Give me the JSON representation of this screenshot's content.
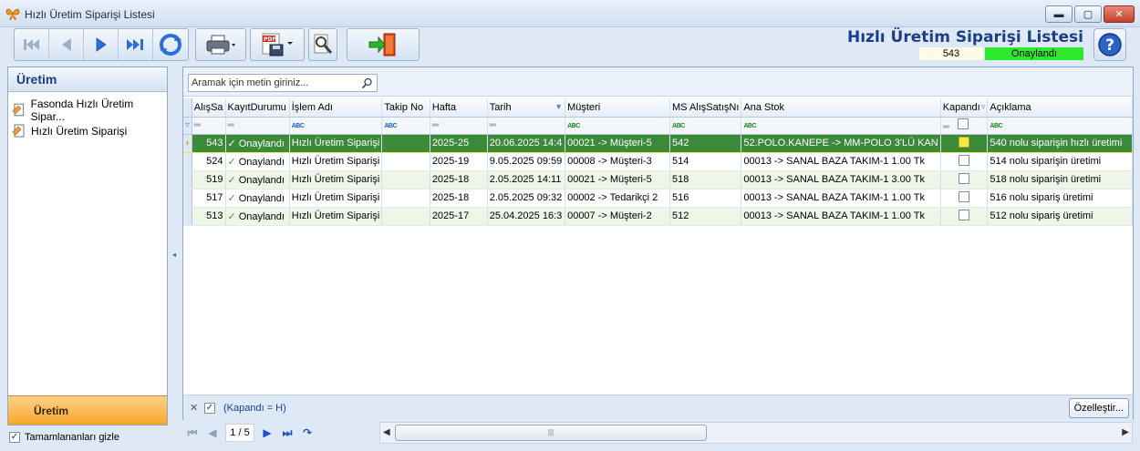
{
  "window": {
    "title": "Hızlı Üretim Siparişi Listesi",
    "buttons": {
      "minimize": "▬",
      "maximize": "▢",
      "close": "✕"
    }
  },
  "toolbar": {
    "buttons": [
      "first-record",
      "previous-record",
      "next-record",
      "last-record",
      "refresh",
      "print",
      "export-pdf",
      "search-settings",
      "exit"
    ]
  },
  "header": {
    "heading": "Hızlı Üretim Siparişi Listesi",
    "record_no": "543",
    "record_status": "Onaylandı"
  },
  "sidebar": {
    "title": "Üretim",
    "items": [
      {
        "label": "Fasonda Hızlı Üretim Sipar..."
      },
      {
        "label": "Hızlı Üretim Siparişi"
      }
    ],
    "footer": "Üretim",
    "hide_completed": {
      "label": "Tamamlananları gizle",
      "checked": true
    }
  },
  "search": {
    "placeholder": "Aramak için metin giriniz..."
  },
  "grid": {
    "columns": [
      "AlışSa",
      "KayıtDurumu",
      "İşlem Adı",
      "Takip No",
      "Hafta",
      "Tarih",
      "Müşteri",
      "MS AlışSatışNı",
      "Ana Stok",
      "Kapandı",
      "Açıklama"
    ],
    "rows": [
      {
        "alis": "543",
        "durum": "Onaylandı",
        "islem": "Hızlı Üretim Siparişi",
        "takip": "",
        "hafta": "2025-25",
        "tarih": "20.06.2025 14:4",
        "musteri": "00021 -> Müşteri-5",
        "ms": "542",
        "stok": "52.POLO.KANEPE -> MM-POLO 3'LÜ KAN",
        "aciklama": "540 nolu siparişin hızlı üretimi"
      },
      {
        "alis": "524",
        "durum": "Onaylandı",
        "islem": "Hızlı Üretim Siparişi",
        "takip": "",
        "hafta": "2025-19",
        "tarih": "9.05.2025 09:59",
        "musteri": "00008 -> Müşteri-3",
        "ms": "514",
        "stok": "00013 -> SANAL BAZA TAKIM-1 1.00 Tk",
        "aciklama": "514 nolu siparişin üretimi"
      },
      {
        "alis": "519",
        "durum": "Onaylandı",
        "islem": "Hızlı Üretim Siparişi",
        "takip": "",
        "hafta": "2025-18",
        "tarih": "2.05.2025 14:11",
        "musteri": "00021 -> Müşteri-5",
        "ms": "518",
        "stok": "00013 -> SANAL BAZA TAKIM-1 3.00 Tk",
        "aciklama": "518 nolu siparişin üretimi"
      },
      {
        "alis": "517",
        "durum": "Onaylandı",
        "islem": "Hızlı Üretim Siparişi",
        "takip": "",
        "hafta": "2025-18",
        "tarih": "2.05.2025 09:32",
        "musteri": "00002 -> Tedarikçi 2",
        "ms": "516",
        "stok": "00013 -> SANAL BAZA TAKIM-1 1.00 Tk",
        "aciklama": "516 nolu sipariş üretimi"
      },
      {
        "alis": "513",
        "durum": "Onaylandı",
        "islem": "Hızlı Üretim Siparişi",
        "takip": "",
        "hafta": "2025-17",
        "tarih": "25.04.2025 16:3",
        "musteri": "00007 -> Müşteri-2",
        "ms": "512",
        "stok": "00013 -> SANAL BAZA TAKIM-1 1.00 Tk",
        "aciklama": "512 nolu sipariş üretimi"
      }
    ]
  },
  "filter": {
    "expression": "(Kapandı = H)",
    "customize_label": "Özelleştir..."
  },
  "pager": {
    "page_text": "1 / 5"
  },
  "colors": {
    "selected_row": "#3a8a3a",
    "status_green": "#2ee82e",
    "accent_orange": "#f7a82a",
    "heading_blue": "#1c3d8a"
  }
}
